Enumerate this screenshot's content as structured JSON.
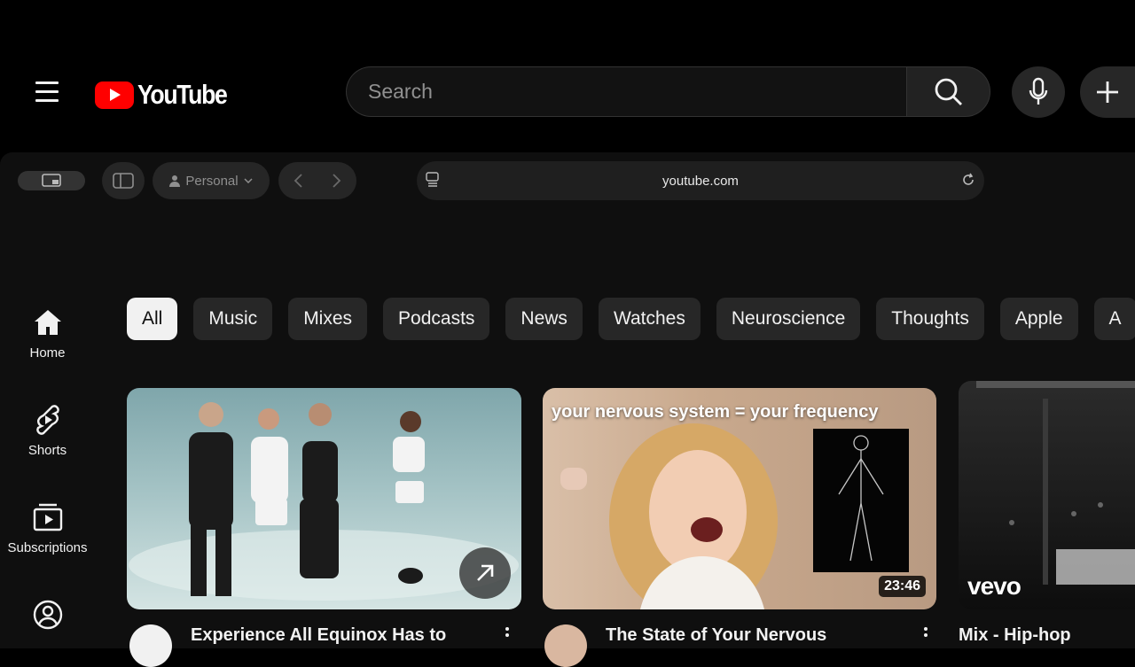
{
  "browser": {
    "profile_label": "Personal",
    "url": "youtube.com"
  },
  "header": {
    "logo_text": "YouTube",
    "search_placeholder": "Search"
  },
  "sidebar": {
    "items": [
      {
        "label": "Home"
      },
      {
        "label": "Shorts"
      },
      {
        "label": "Subscriptions"
      },
      {
        "label": ""
      }
    ]
  },
  "chips": [
    "All",
    "Music",
    "Mixes",
    "Podcasts",
    "News",
    "Watches",
    "Neuroscience",
    "Thoughts",
    "Apple",
    "A"
  ],
  "videos": [
    {
      "title": "Experience All Equinox Has to",
      "overlay": "",
      "duration": ""
    },
    {
      "title": "The State of Your Nervous",
      "overlay": "your nervous system = your frequency",
      "duration": "23:46"
    },
    {
      "title": "Mix - Hip-hop",
      "overlay": "",
      "badge": "vevo"
    }
  ],
  "colors": {
    "brand": "#ff0000",
    "bg": "#0f0f0f",
    "chip": "#272727"
  }
}
